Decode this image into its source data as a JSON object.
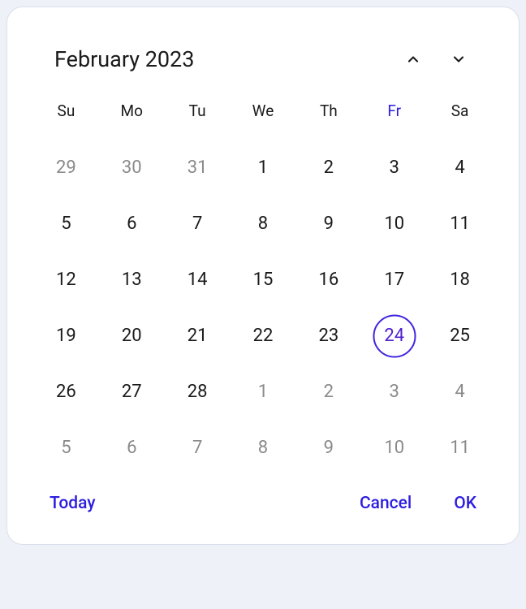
{
  "title": "February 2023",
  "dow": [
    "Su",
    "Mo",
    "Tu",
    "We",
    "Th",
    "Fr",
    "Sa"
  ],
  "todayCol": 5,
  "days": [
    {
      "d": "29",
      "out": true
    },
    {
      "d": "30",
      "out": true
    },
    {
      "d": "31",
      "out": true
    },
    {
      "d": "1"
    },
    {
      "d": "2"
    },
    {
      "d": "3"
    },
    {
      "d": "4"
    },
    {
      "d": "5"
    },
    {
      "d": "6"
    },
    {
      "d": "7"
    },
    {
      "d": "8"
    },
    {
      "d": "9"
    },
    {
      "d": "10"
    },
    {
      "d": "11"
    },
    {
      "d": "12"
    },
    {
      "d": "13"
    },
    {
      "d": "14"
    },
    {
      "d": "15"
    },
    {
      "d": "16"
    },
    {
      "d": "17"
    },
    {
      "d": "18"
    },
    {
      "d": "19"
    },
    {
      "d": "20"
    },
    {
      "d": "21"
    },
    {
      "d": "22"
    },
    {
      "d": "23"
    },
    {
      "d": "24",
      "today": true
    },
    {
      "d": "25"
    },
    {
      "d": "26"
    },
    {
      "d": "27"
    },
    {
      "d": "28"
    },
    {
      "d": "1",
      "out": true
    },
    {
      "d": "2",
      "out": true
    },
    {
      "d": "3",
      "out": true
    },
    {
      "d": "4",
      "out": true
    },
    {
      "d": "5",
      "out": true
    },
    {
      "d": "6",
      "out": true
    },
    {
      "d": "7",
      "out": true
    },
    {
      "d": "8",
      "out": true
    },
    {
      "d": "9",
      "out": true
    },
    {
      "d": "10",
      "out": true
    },
    {
      "d": "11",
      "out": true
    }
  ],
  "footer": {
    "today": "Today",
    "cancel": "Cancel",
    "ok": "OK"
  }
}
